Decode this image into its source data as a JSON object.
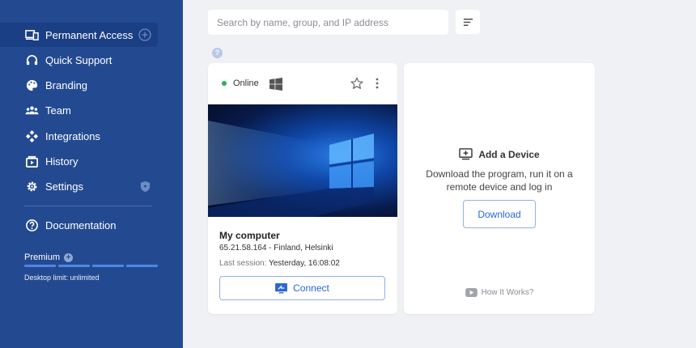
{
  "sidebar": {
    "items": [
      {
        "label": "Permanent Access",
        "icon": "devices-icon"
      },
      {
        "label": "Quick Support",
        "icon": "headset-icon"
      },
      {
        "label": "Branding",
        "icon": "palette-icon"
      },
      {
        "label": "Team",
        "icon": "team-icon"
      },
      {
        "label": "Integrations",
        "icon": "integrations-icon"
      },
      {
        "label": "History",
        "icon": "history-icon"
      },
      {
        "label": "Settings",
        "icon": "gear-icon"
      }
    ],
    "documentation": {
      "label": "Documentation",
      "icon": "question-circle-icon"
    },
    "plan": {
      "label": "Premium",
      "limit": "Desktop limit: unlimited"
    }
  },
  "search": {
    "placeholder": "Search by name, group, and IP address"
  },
  "device": {
    "status": "Online",
    "status_color": "#22b45a",
    "os": "windows-icon",
    "name": "My computer",
    "ip_location": "65.21.58.164 - Finland, Helsinki",
    "last_session_label": "Last session:",
    "last_session_value": "Yesterday, 16:08:02",
    "connect_label": "Connect"
  },
  "add_device": {
    "title": "Add a Device",
    "description": "Download the program, run it on a remote device and log in",
    "download_label": "Download",
    "how_it_works": "How It Works?"
  },
  "colors": {
    "sidebar": "#234a91",
    "accent": "#2b66d8",
    "background": "#f0f1f4"
  }
}
